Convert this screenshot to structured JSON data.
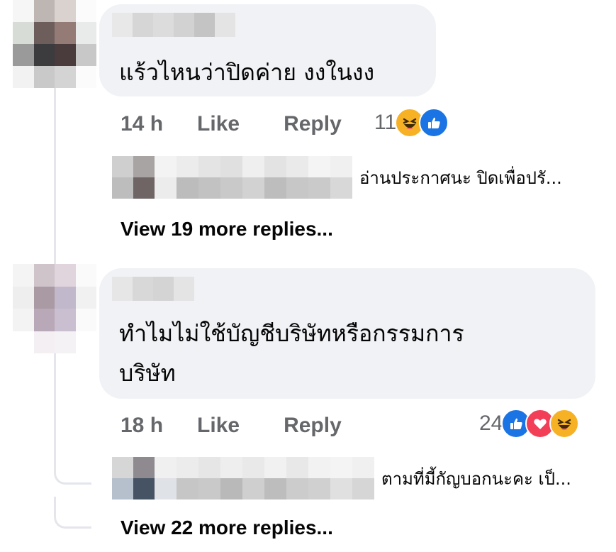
{
  "comments": [
    {
      "text": "แร้วไหนว่าปิดค่าย งงในงง",
      "time": "14 h",
      "like_label": "Like",
      "reply_label": "Reply",
      "reaction_count": "11",
      "reactions": [
        "haha-icon",
        "like-icon"
      ],
      "reply_preview": "อ่านประกาศนะ ปิดเพื่อปรั...",
      "view_more": "View 19 more replies..."
    },
    {
      "text_line1": "ทำไมไม่ใช้บัญชีบริษัทหรือกรรมการ",
      "text_line2": "บริษัท",
      "time": "18 h",
      "like_label": "Like",
      "reply_label": "Reply",
      "reaction_count": "24",
      "reactions": [
        "like-icon",
        "love-icon",
        "haha-icon"
      ],
      "reply_preview": "ตามที่มี้กัญบอกนะคะ เป็...",
      "view_more": "View 22 more replies..."
    }
  ],
  "colors": {
    "bubble": "#f0f2f5",
    "meta_text": "#65676b",
    "like_blue": "#1b74e4",
    "haha_yellow": "#f7b125",
    "love_red": "#f33e58"
  }
}
